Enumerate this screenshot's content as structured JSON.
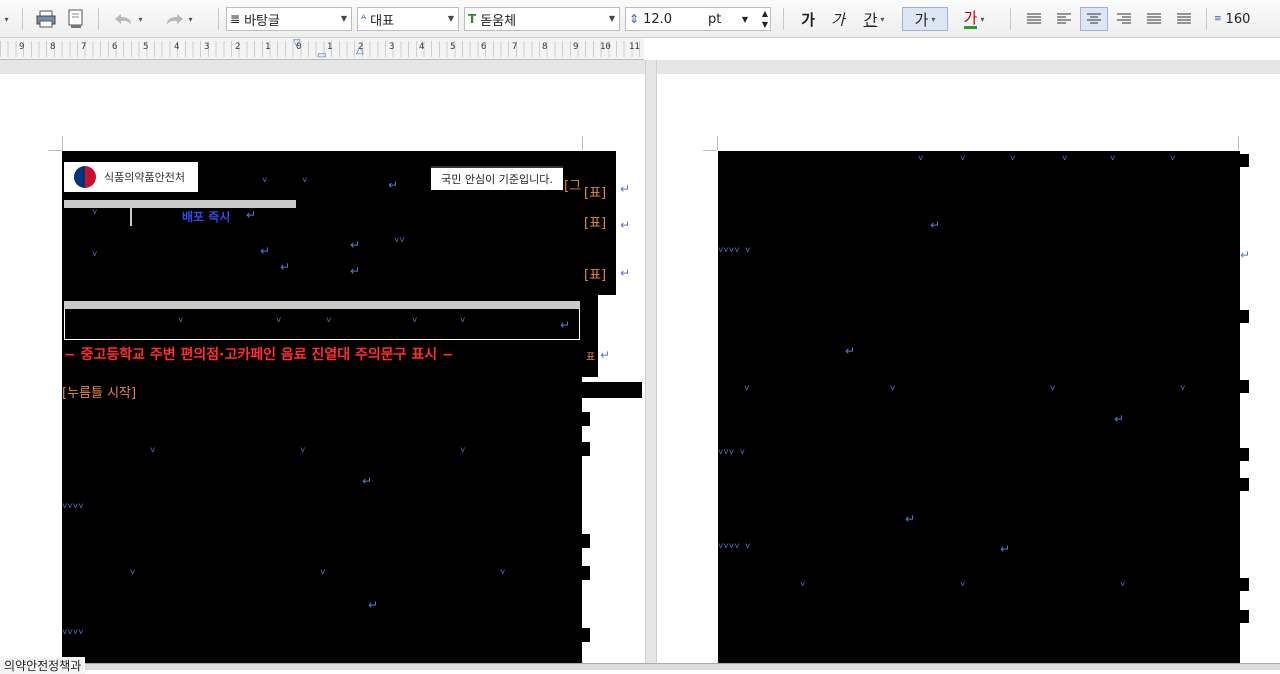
{
  "toolbar": {
    "style_combo": "바탕글",
    "lang_combo": "대표",
    "font_combo": "돋움체",
    "size_value": "12.0",
    "size_unit": "pt",
    "bold_glyph": "가",
    "italic_glyph": "가",
    "underline_glyph": "간",
    "strike_glyph": "가",
    "color_glyph": "가",
    "line_spacing_label": "160",
    "icons": [
      "printer-icon",
      "preview-icon",
      "undo-icon",
      "redo-icon",
      "style-icon",
      "font-lang-icon",
      "font-icon",
      "font-size-icon",
      "align-justify-icon",
      "align-left-icon",
      "align-center-icon",
      "align-right-icon",
      "distribute-icon",
      "divide-icon",
      "line-spacing-icon"
    ],
    "accent_color": "#3a6fb5"
  },
  "ruler": {
    "numbers": [
      "9",
      "8",
      "7",
      "6",
      "5",
      "4",
      "3",
      "2",
      "1",
      "0",
      "1",
      "2",
      "3",
      "4",
      "5",
      "6",
      "7",
      "8",
      "9",
      "10",
      "11"
    ]
  },
  "document": {
    "logo_text": "식품의약품안전처",
    "slogan_text": "국민 안심이 기준입니다.",
    "header_cell": "배포 즉시",
    "table_field_tags": [
      "[표]",
      "[표]",
      "[표]"
    ],
    "table_bracket": "[그",
    "red_title": "− 중고등학교 주변 편의점·고카페인 음료 진열대 주의문구 표시 −",
    "red_color": "#ff2d2d",
    "field_tag_color": "#e7893a",
    "field_start_label": "[누름틀 시작]",
    "right_mark": "표"
  },
  "status": {
    "tab_label": "의약안전정책과"
  }
}
